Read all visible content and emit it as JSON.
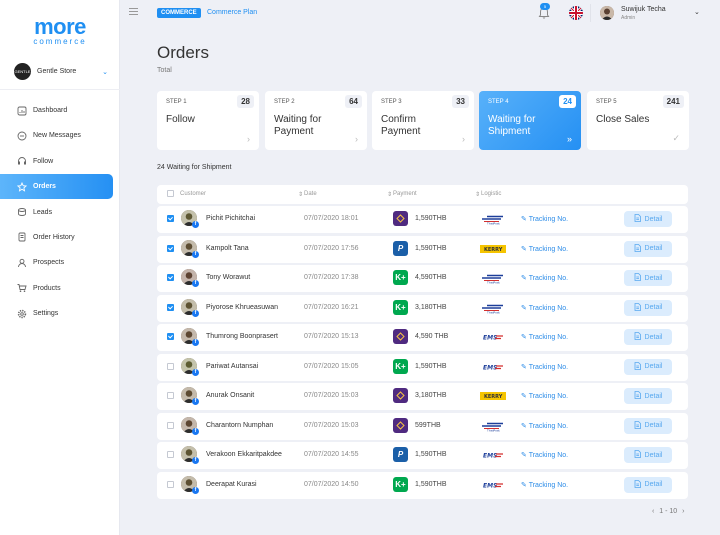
{
  "brand": {
    "name": "more",
    "sub": "commerce"
  },
  "store": {
    "avatar_text": "GENTLE",
    "name": "Gentle Store"
  },
  "nav": [
    {
      "label": "Dashboard",
      "icon": "dashboard-icon"
    },
    {
      "label": "New Messages",
      "icon": "chat-icon"
    },
    {
      "label": "Follow",
      "icon": "headset-icon"
    },
    {
      "label": "Orders",
      "icon": "star-icon",
      "active": true
    },
    {
      "label": "Leads",
      "icon": "coins-icon"
    },
    {
      "label": "Order History",
      "icon": "history-icon"
    },
    {
      "label": "Prospects",
      "icon": "user-icon"
    },
    {
      "label": "Products",
      "icon": "cart-icon"
    },
    {
      "label": "Settings",
      "icon": "gear-icon"
    }
  ],
  "topbar": {
    "badge": "COMMERCE",
    "plan": "Commerce Plan",
    "bell_count": "5",
    "user_name": "Suwijuk Techa",
    "user_role": "Admin"
  },
  "page": {
    "title": "Orders",
    "subtitle": "Total"
  },
  "steps": [
    {
      "step": "STEP 1",
      "count": "28",
      "title": "Follow"
    },
    {
      "step": "STEP 2",
      "count": "64",
      "title": "Waiting for Payment"
    },
    {
      "step": "STEP 3",
      "count": "33",
      "title": "Confirm Payment"
    },
    {
      "step": "STEP 4",
      "count": "24",
      "title": "Waiting for Shipment",
      "active": true
    },
    {
      "step": "STEP 5",
      "count": "241",
      "title": "Close Sales"
    }
  ],
  "count_label": "24 Waiting for Shipment",
  "table": {
    "headers": {
      "customer": "Customer",
      "date": "Date",
      "payment": "Payment",
      "logistic": "Logistic"
    },
    "rows": [
      {
        "checked": true,
        "name": "Pichit Pichitchai",
        "date": "07/07/2020  18:01",
        "pay": "scb",
        "amount": "1,590THB",
        "logistic": "thaipost",
        "tracking": "Tracking No.",
        "action": "Detail"
      },
      {
        "checked": true,
        "name": "Kampolt Tana",
        "date": "07/07/2020  17:56",
        "pay": "paypal",
        "amount": "1,590THB",
        "logistic": "kerry",
        "tracking": "Tracking No.",
        "action": "Detail"
      },
      {
        "checked": true,
        "name": "Tony Worawut",
        "date": "07/07/2020  17:38",
        "pay": "kbank",
        "amount": "4,590THB",
        "logistic": "thaipost",
        "tracking": "Tracking No.",
        "action": "Detail"
      },
      {
        "checked": true,
        "name": "Piyorose Khrueasuwan",
        "date": "07/07/2020  16:21",
        "pay": "kbank",
        "amount": "3,180THB",
        "logistic": "thaipost",
        "tracking": "Tracking No.",
        "action": "Detail"
      },
      {
        "checked": true,
        "name": "Thumrong Boonprasert",
        "date": "07/07/2020  15:13",
        "pay": "scb",
        "amount": "4,590 THB",
        "logistic": "ems",
        "tracking": "Tracking No.",
        "action": "Detail"
      },
      {
        "checked": false,
        "name": "Pariwat Autansai",
        "date": "07/07/2020  15:05",
        "pay": "kbank",
        "amount": "1,590THB",
        "logistic": "ems",
        "tracking": "Tracking No.",
        "action": "Detail"
      },
      {
        "checked": false,
        "name": "Anurak  Onsanit",
        "date": "07/07/2020  15:03",
        "pay": "scb",
        "amount": "3,180THB",
        "logistic": "kerry",
        "tracking": "Tracking No.",
        "action": "Detail"
      },
      {
        "checked": false,
        "name": "Charantorn Numphan",
        "date": "07/07/2020  15:03",
        "pay": "scb",
        "amount": "599THB",
        "logistic": "thaipost",
        "tracking": "Tracking No.",
        "action": "Detail"
      },
      {
        "checked": false,
        "name": "Verakoon Ekkaritpakdee",
        "date": "07/07/2020  14:55",
        "pay": "paypal",
        "amount": "1,590THB",
        "logistic": "ems",
        "tracking": "Tracking No.",
        "action": "Detail"
      },
      {
        "checked": false,
        "name": "Deerapat Kurasi",
        "date": "07/07/2020  14:50",
        "pay": "kbank",
        "amount": "1,590THB",
        "logistic": "ems",
        "tracking": "Tracking No.",
        "action": "Detail"
      }
    ]
  },
  "pager": {
    "range": "1 - 10"
  },
  "colors": {
    "accent": "#1f8ff2",
    "kbank": "#00a84f",
    "scb": "#4f2a80",
    "paypal": "#1b5fa8"
  }
}
